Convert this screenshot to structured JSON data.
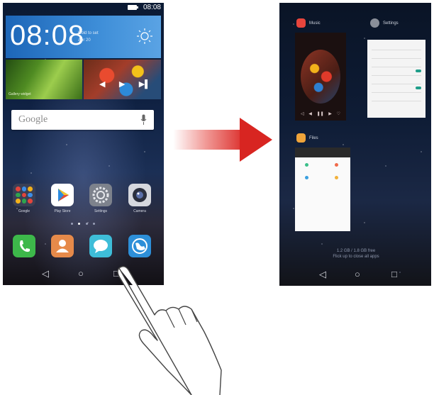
{
  "left_phone": {
    "status_time": "08:08",
    "clock": {
      "time": "08:08",
      "sub_line1": "Hold to set",
      "sub_line2": "Apr 20"
    },
    "gallery_caption": "Gallery widget",
    "music_controls": [
      "◀",
      "▶",
      "▶▌"
    ],
    "search": {
      "placeholder": "Google"
    },
    "apps": [
      {
        "label": "Google",
        "color": "#3a3f55"
      },
      {
        "label": "Play Store",
        "color": "#ffffff"
      },
      {
        "label": "Settings",
        "color": "#7d828c"
      },
      {
        "label": "Camera",
        "color": "#d6d8de"
      }
    ],
    "dock": [
      {
        "name": "phone",
        "color": "#3db84a"
      },
      {
        "name": "contacts",
        "color": "#e68a4a"
      },
      {
        "name": "messages",
        "color": "#3ebdd8"
      },
      {
        "name": "browser",
        "color": "#2d8fd8"
      }
    ],
    "nav": {
      "back": "◁",
      "home": "○",
      "recent": "□"
    }
  },
  "right_phone": {
    "cards": [
      {
        "title": "Music",
        "icon_color": "#e8453c"
      },
      {
        "title": "Settings",
        "icon_color": "#8a8f99"
      },
      {
        "title": "Files",
        "icon_color": "#f0a43a"
      }
    ],
    "caption_line1": "1.2 GB / 1.8 GB free",
    "caption_line2": "Flick up to close all apps",
    "nav": {
      "back": "◁",
      "home": "○",
      "recent": "□"
    }
  },
  "colors": {
    "arrow": "#d82521"
  }
}
